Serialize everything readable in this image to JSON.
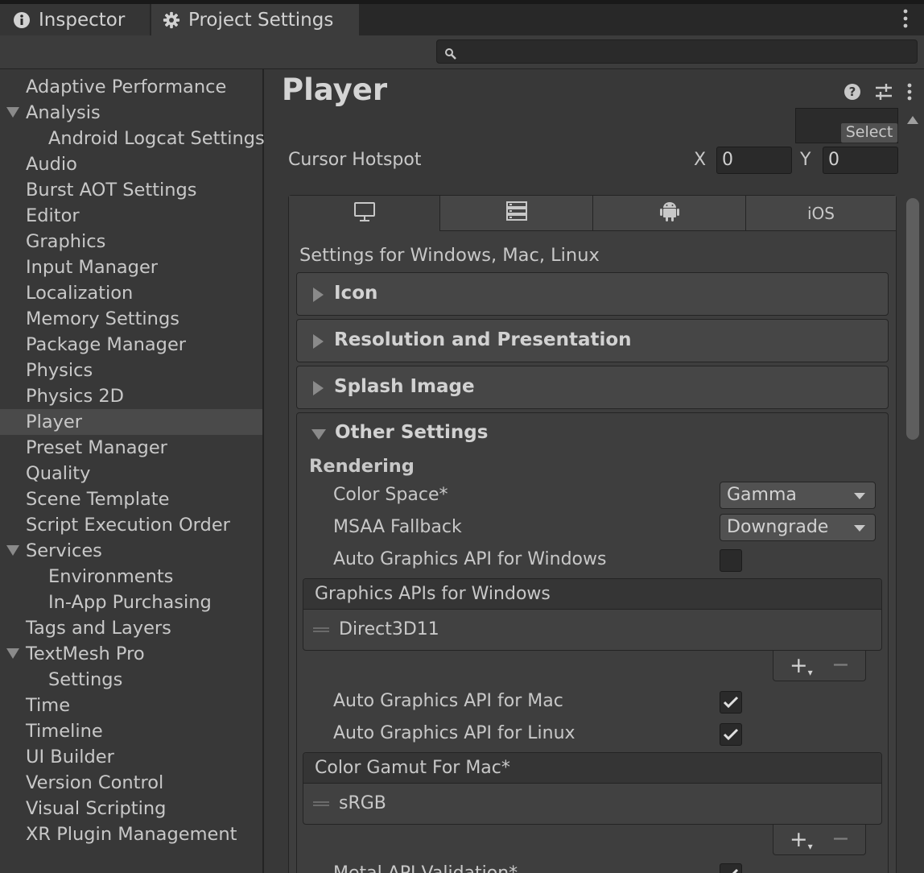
{
  "tabs": [
    {
      "label": "Inspector",
      "icon": "info-icon"
    },
    {
      "label": "Project Settings",
      "icon": "gear-icon"
    }
  ],
  "search": {
    "placeholder": ""
  },
  "sidebar": {
    "items": [
      {
        "label": "Adaptive Performance"
      },
      {
        "label": "Analysis"
      },
      {
        "label": "Android Logcat Settings"
      },
      {
        "label": "Audio"
      },
      {
        "label": "Burst AOT Settings"
      },
      {
        "label": "Editor"
      },
      {
        "label": "Graphics"
      },
      {
        "label": "Input Manager"
      },
      {
        "label": "Localization"
      },
      {
        "label": "Memory Settings"
      },
      {
        "label": "Package Manager"
      },
      {
        "label": "Physics"
      },
      {
        "label": "Physics 2D"
      },
      {
        "label": "Player"
      },
      {
        "label": "Preset Manager"
      },
      {
        "label": "Quality"
      },
      {
        "label": "Scene Template"
      },
      {
        "label": "Script Execution Order"
      },
      {
        "label": "Services"
      },
      {
        "label": "Environments"
      },
      {
        "label": "In-App Purchasing"
      },
      {
        "label": "Tags and Layers"
      },
      {
        "label": "TextMesh Pro"
      },
      {
        "label": "Settings"
      },
      {
        "label": "Time"
      },
      {
        "label": "Timeline"
      },
      {
        "label": "UI Builder"
      },
      {
        "label": "Version Control"
      },
      {
        "label": "Visual Scripting"
      },
      {
        "label": "XR Plugin Management"
      }
    ]
  },
  "main": {
    "title": "Player",
    "select_label": "Select",
    "cursor_hotspot": {
      "label": "Cursor Hotspot",
      "x_label": "X",
      "x_value": "0",
      "y_label": "Y",
      "y_value": "0"
    },
    "platform_tabs": [
      {
        "icon": "monitor-icon",
        "label": ""
      },
      {
        "icon": "server-icon",
        "label": ""
      },
      {
        "icon": "android-icon",
        "label": ""
      },
      {
        "icon": "",
        "label": "iOS"
      }
    ],
    "settings_for": "Settings for Windows, Mac, Linux",
    "foldouts": [
      "Icon",
      "Resolution and Presentation",
      "Splash Image"
    ],
    "other_settings": {
      "title": "Other Settings",
      "rendering": "Rendering",
      "color_space_label": "Color Space*",
      "color_space_value": "Gamma",
      "msaa_label": "MSAA Fallback",
      "msaa_value": "Downgrade",
      "auto_windows_label": "Auto Graphics API  for Windows",
      "auto_windows_checked": false,
      "graphics_apis_header": "Graphics APIs for Windows",
      "graphics_apis_items": [
        "Direct3D11"
      ],
      "auto_mac_label": "Auto Graphics API  for Mac",
      "auto_mac_checked": true,
      "auto_linux_label": "Auto Graphics API  for Linux",
      "auto_linux_checked": true,
      "color_gamut_header": "Color Gamut For Mac*",
      "color_gamut_items": [
        "sRGB"
      ],
      "metal_validation_label": "Metal API Validation*",
      "metal_validation_checked": true
    }
  },
  "colors": {
    "background": "#383838",
    "selected": "#4a4a4a",
    "field": "#2a2a2a"
  }
}
